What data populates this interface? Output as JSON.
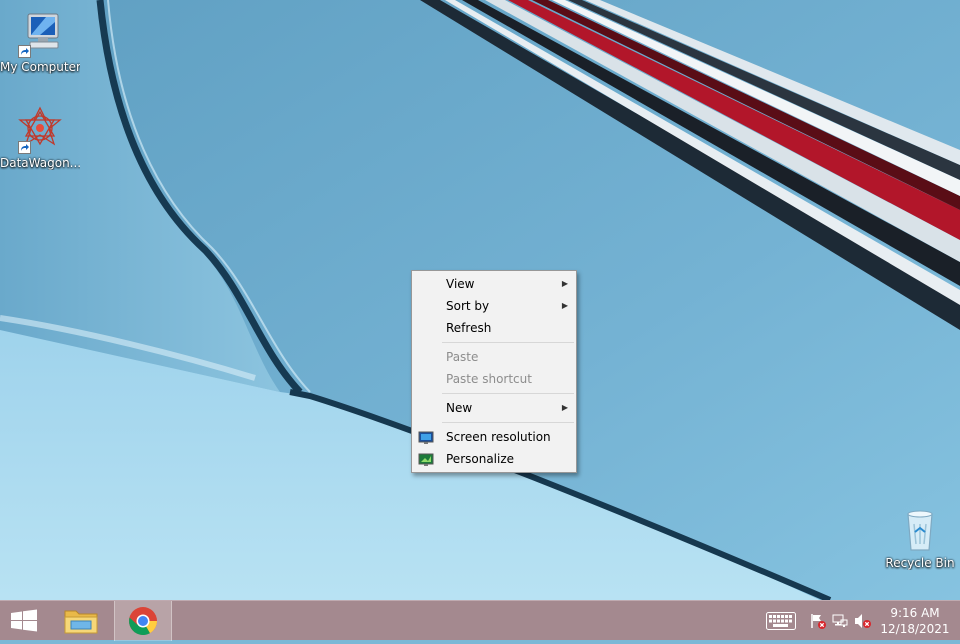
{
  "desktop": {
    "icons": [
      {
        "label": "My Computer",
        "icon": "my-computer-icon"
      },
      {
        "label": "DataWagon...",
        "icon": "datawagon-icon"
      },
      {
        "label": "Recycle Bin",
        "icon": "recycle-bin-icon"
      }
    ]
  },
  "context_menu": {
    "items": [
      {
        "label": "View",
        "submenu": true,
        "enabled": true
      },
      {
        "label": "Sort by",
        "submenu": true,
        "enabled": true
      },
      {
        "label": "Refresh",
        "enabled": true
      },
      {
        "label": "Paste",
        "enabled": false
      },
      {
        "label": "Paste shortcut",
        "enabled": false
      },
      {
        "label": "New",
        "submenu": true,
        "enabled": true
      },
      {
        "label": "Screen resolution",
        "icon": "monitor-icon",
        "enabled": true
      },
      {
        "label": "Personalize",
        "icon": "personalize-icon",
        "enabled": true
      }
    ]
  },
  "taskbar": {
    "pinned": [
      "start-icon",
      "file-explorer-icon",
      "chrome-icon"
    ],
    "tray_icons": [
      "keyboard-icon",
      "action-center-flag-icon",
      "network-icon",
      "volume-muted-icon"
    ],
    "clock": {
      "time": "9:16 AM",
      "date": "12/18/2021"
    }
  },
  "colors": {
    "taskbar": "#a4898f",
    "wallpaper_sky": "#7bb8d6",
    "menu_bg": "#f2f2f2"
  }
}
